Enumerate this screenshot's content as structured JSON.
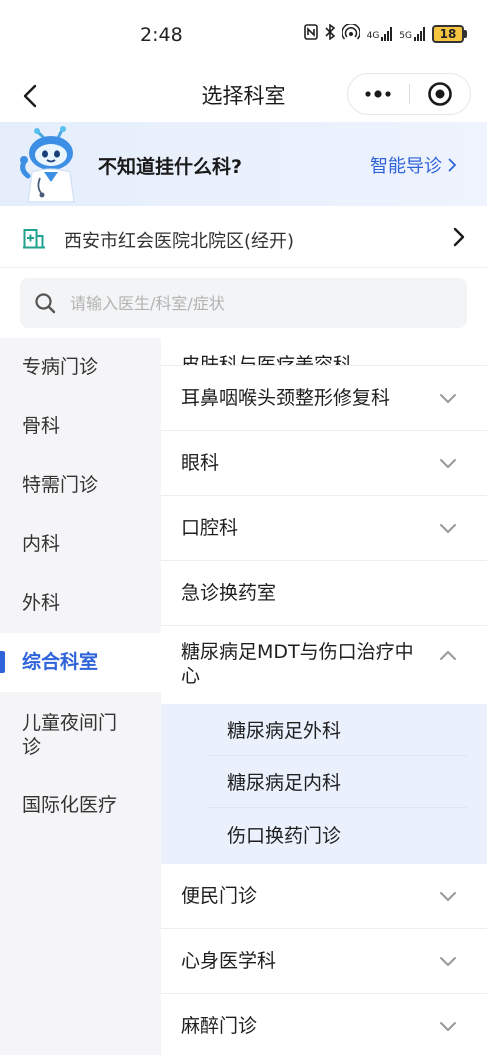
{
  "status_bar": {
    "time": "2:48",
    "signal_label_1": "4G",
    "signal_label_2": "5G",
    "battery": "18"
  },
  "nav": {
    "title": "选择科室"
  },
  "banner": {
    "question": "不知道挂什么科?",
    "link_label": "智能导诊"
  },
  "hospital": {
    "name": "西安市红会医院北院区(经开)"
  },
  "search": {
    "placeholder": "请输入医生/科室/症状"
  },
  "left_nav": {
    "items": [
      {
        "label": "专病门诊"
      },
      {
        "label": "骨科"
      },
      {
        "label": "特需门诊"
      },
      {
        "label": "内科"
      },
      {
        "label": "外科"
      },
      {
        "label": "综合科室"
      },
      {
        "label": "儿童夜间门诊"
      },
      {
        "label": "国际化医疗"
      }
    ],
    "active_label": "综合科室"
  },
  "departments": {
    "partial_label": "皮肤科与医疗美容科",
    "rows_before": [
      {
        "label": "耳鼻咽喉头颈整形修复科"
      },
      {
        "label": "眼科"
      },
      {
        "label": "口腔科"
      },
      {
        "label": "急诊换药室"
      }
    ],
    "expanded": {
      "label": "糖尿病足MDT与伤口治疗中心",
      "children": [
        {
          "label": "糖尿病足外科"
        },
        {
          "label": "糖尿病足内科"
        },
        {
          "label": "伤口换药门诊"
        }
      ]
    },
    "rows_after": [
      {
        "label": "便民门诊"
      },
      {
        "label": "心身医学科"
      },
      {
        "label": "麻醉门诊"
      }
    ]
  },
  "colors": {
    "accent": "#2f63d9",
    "banner_bg": "#e6eefc",
    "left_nav_bg": "#f5f5f7",
    "sub_panel_bg": "#eaf1fd"
  }
}
